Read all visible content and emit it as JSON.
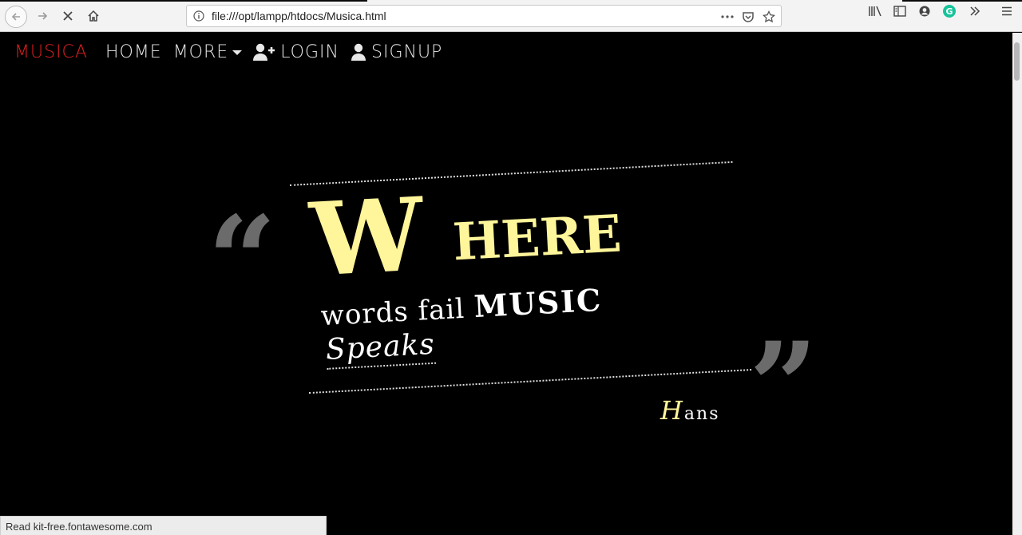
{
  "browser": {
    "url": "file:///opt/lampp/htdocs/Musica.html",
    "status_text": "Read kit-free.fontawesome.com",
    "icons": [
      "back-icon",
      "forward-icon",
      "stop-icon",
      "home-icon",
      "info-icon",
      "more-icon",
      "pocket-icon",
      "bookmark-star-icon",
      "library-icon",
      "sidebar-icon",
      "account-icon",
      "grammarly-icon",
      "overflow-icon",
      "menu-icon"
    ]
  },
  "nav": {
    "brand": "MUSICA",
    "items": [
      {
        "label": "HOME"
      },
      {
        "label": "MORE"
      },
      {
        "label": "LOGIN",
        "icon": "user-plus-icon"
      },
      {
        "label": "SIGNUP",
        "icon": "user-icon"
      }
    ]
  },
  "quote": {
    "big_letter": "W",
    "rest_word": "HERE",
    "line2_start": "words fail",
    "line2_emph": "MUSIC",
    "line3": "Speaks",
    "author_initial": "H",
    "author_rest": "ans",
    "open_mark": "“",
    "close_mark": "”"
  },
  "colors": {
    "brand": "#e02020",
    "accent_yellow": "#fff59a",
    "quote_mark": "#6b6b6b",
    "background": "#000000"
  }
}
